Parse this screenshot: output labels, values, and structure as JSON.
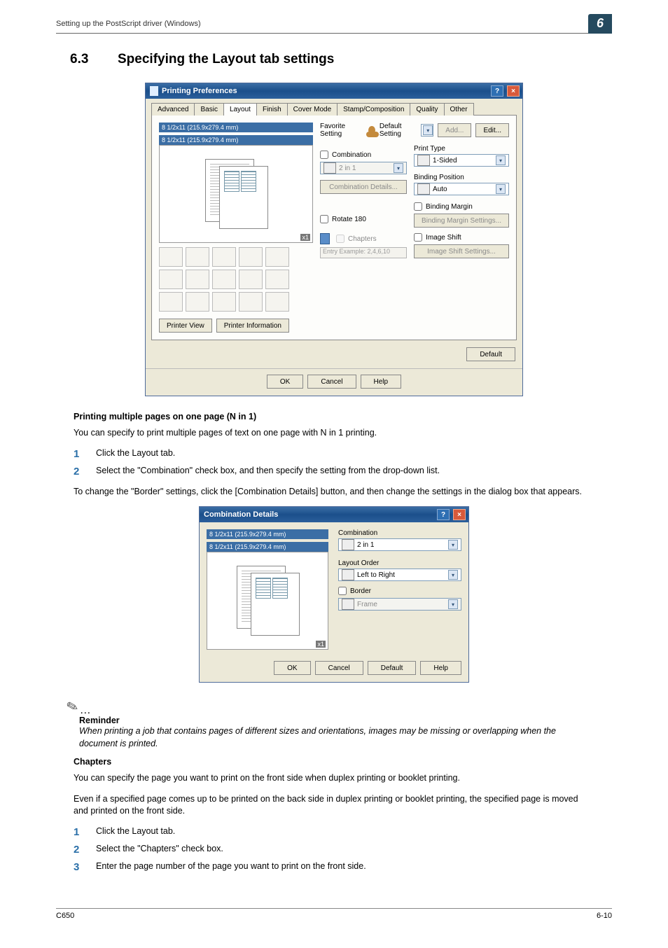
{
  "header": {
    "path": "Setting up the PostScript driver (Windows)",
    "chapter_num": "6"
  },
  "section": {
    "num": "6.3",
    "title": "Specifying the Layout tab settings"
  },
  "pp": {
    "title": "Printing Preferences",
    "tabs": [
      "Advanced",
      "Basic",
      "Layout",
      "Finish",
      "Cover Mode",
      "Stamp/Composition",
      "Quality",
      "Other"
    ],
    "active_tab": "Layout",
    "paper_line1": "8 1/2x11 (215.9x279.4 mm)",
    "paper_line2": "8 1/2x11 (215.9x279.4 mm)",
    "x1": "x1",
    "printer_view": "Printer View",
    "printer_info": "Printer Information",
    "fav_label": "Favorite Setting",
    "fav_value": "Default Setting",
    "add": "Add...",
    "edit": "Edit...",
    "combination": "Combination",
    "combo_value": "2 in 1",
    "combo_details": "Combination Details...",
    "rotate": "Rotate 180",
    "chapters": "Chapters",
    "entry_example": "Entry Example: 2,4,6,10",
    "print_type_label": "Print Type",
    "print_type_value": "1-Sided",
    "binding_pos_label": "Binding Position",
    "binding_pos_value": "Auto",
    "binding_margin": "Binding Margin",
    "binding_margin_btn": "Binding Margin Settings...",
    "image_shift": "Image Shift",
    "image_shift_btn": "Image Shift Settings...",
    "default": "Default",
    "ok": "OK",
    "cancel": "Cancel",
    "help": "Help"
  },
  "cd": {
    "title": "Combination Details",
    "paper_line1": "8 1/2x11 (215.9x279.4 mm)",
    "paper_line2": "8 1/2x11 (215.9x279.4 mm)",
    "x1": "x1",
    "combination": "Combination",
    "combo_value": "2 in 1",
    "layout_order": "Layout Order",
    "layout_order_value": "Left to Right",
    "border": "Border",
    "border_value": "Frame",
    "ok": "OK",
    "cancel": "Cancel",
    "default": "Default",
    "help": "Help"
  },
  "t1_heading": "Printing multiple pages on one page (N in 1)",
  "t1_intro": "You can specify to print multiple pages of text on one page with N in 1 printing.",
  "t1_step1": "Click the Layout tab.",
  "t1_step2": "Select the \"Combination\" check box, and then specify the setting from the drop-down list.",
  "t1_after": "To change the \"Border\" settings, click the [Combination Details] button, and then change the settings in the dialog box that appears.",
  "note_title": "Reminder",
  "note_body": "When printing a job that contains pages of different sizes and orientations, images may be missing or overlapping when the document is printed.",
  "t2_heading": "Chapters",
  "t2_p1": "You can specify the page you want to print on the front side when duplex printing or booklet printing.",
  "t2_p2": "Even if a specified page comes up to be printed on the back side in duplex printing or booklet printing, the specified page is moved and printed on the front side.",
  "t2_step1": "Click the Layout tab.",
  "t2_step2": "Select the \"Chapters\" check box.",
  "t2_step3": "Enter the page number of the page you want to print on the front side.",
  "footer": {
    "left": "C650",
    "right": "6-10"
  }
}
